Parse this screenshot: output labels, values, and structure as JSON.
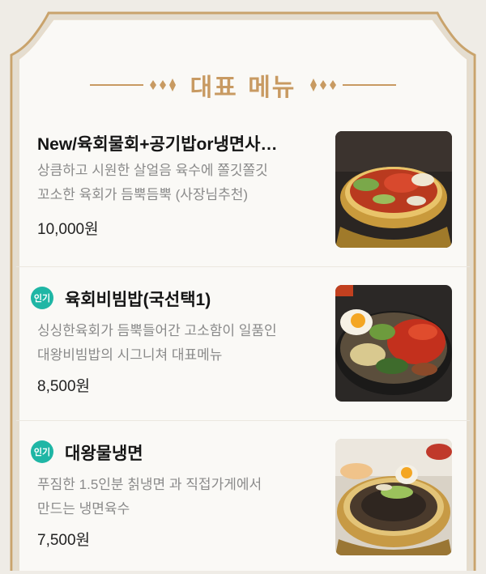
{
  "section": {
    "title": "대표 메뉴"
  },
  "colors": {
    "accent_gold": "#c89a62",
    "badge_teal": "#1fb6a5",
    "price_text": "#222222",
    "desc_text": "#8a8a8a"
  },
  "menu": [
    {
      "name": "New/육회물회+공기밥or냉면사…",
      "badge": "",
      "desc_line1": "상큼하고 시원한 살얼음 육수에 쫄깃쫄깃",
      "desc_line2": "꼬소한 육회가 듬뿍듬뿍 (사장님추천)",
      "price": "10,000원",
      "image_icon": "naengmyeon-raw-beef-photo"
    },
    {
      "name": "육회비빔밥(국선택1)",
      "badge": "인기",
      "desc_line1": "싱싱한육회가 듬뿍들어간 고소함이 일품인",
      "desc_line2": "대왕비빔밥의 시그니쳐 대표메뉴",
      "price": "8,500원",
      "image_icon": "bibimbap-photo"
    },
    {
      "name": "대왕물냉면",
      "badge": "인기",
      "desc_line1": "푸짐한 1.5인분 칡냉면 과 직접가게에서",
      "desc_line2": "만드는 냉면육수",
      "price": "7,500원",
      "image_icon": "mul-naengmyeon-photo"
    }
  ]
}
